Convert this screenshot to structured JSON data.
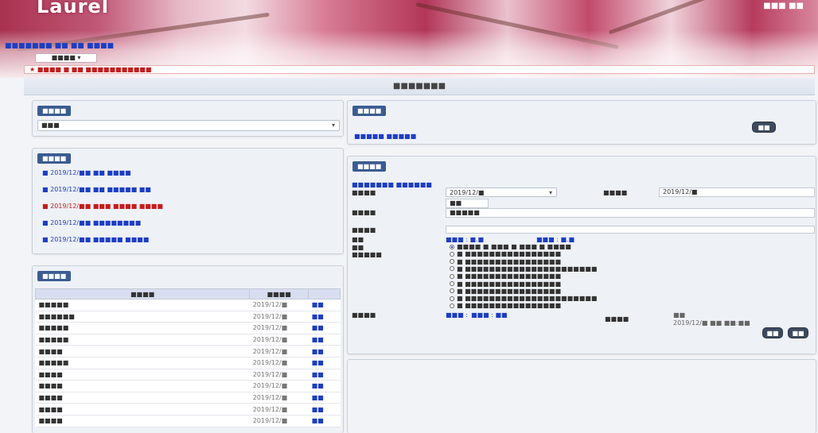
{
  "header": {
    "logo": "Laurel",
    "user": "■■■ ■■",
    "breadcrumb": "■■■■■■■ ■■ ■■ ■■■■",
    "system_button": "■■■■ ▾",
    "notice": "★ ■■■■ ■ ■■ ■■■■■■■■■■■"
  },
  "page_title": "■■■■■■■",
  "category_panel": {
    "header": "■■■■",
    "select_value": "■■■"
  },
  "recent_panel": {
    "header": "■■■■",
    "items": [
      {
        "label": "■ 2019/12/■■ ■■ ■■■■",
        "active": false
      },
      {
        "label": "■ 2019/12/■■ ■■ ■■■■■ ■■",
        "active": false
      },
      {
        "label": "■ 2019/12/■■ ■■■ ■■■■ ■■■■",
        "active": true
      },
      {
        "label": "■ 2019/12/■■ ■■■■■■■■",
        "active": false
      },
      {
        "label": "■ 2019/12/■■ ■■■■■ ■■■■",
        "active": false
      }
    ]
  },
  "list_panel": {
    "header": "■■■■",
    "columns": [
      "■■■■",
      "■■■■",
      ""
    ],
    "rows": [
      {
        "name": "■■■■■",
        "date": "2019/12/■",
        "action": "■■"
      },
      {
        "name": "■■■■■■",
        "date": "2019/12/■",
        "action": "■■"
      },
      {
        "name": "■■■■■",
        "date": "2019/12/■",
        "action": "■■"
      },
      {
        "name": "■■■■■",
        "date": "2019/12/■",
        "action": "■■"
      },
      {
        "name": "■■■■",
        "date": "2019/12/■",
        "action": "■■"
      },
      {
        "name": "■■■■■",
        "date": "2019/12/■",
        "action": "■■"
      },
      {
        "name": "■■■■",
        "date": "2019/12/■",
        "action": "■■"
      },
      {
        "name": "■■■■",
        "date": "2019/12/■",
        "action": "■■"
      },
      {
        "name": "■■■■",
        "date": "2019/12/■",
        "action": "■■"
      },
      {
        "name": "■■■■",
        "date": "2019/12/■",
        "action": "■■"
      },
      {
        "name": "■■■■",
        "date": "2019/12/■",
        "action": "■■"
      }
    ]
  },
  "search_panel": {
    "header": "■■■■",
    "button": "■■",
    "link": "■■■■■ ■■■■■"
  },
  "detail_panel": {
    "header": "■■■■",
    "top_links": "■■■■■■■ ■■■■■■",
    "fields": {
      "type_label": "■■■■",
      "type_value": "2019/12/■",
      "date_label": "■■■■",
      "date_value": "2019/12/■",
      "code_value": "■■",
      "title_label": "■■■■",
      "title_value": "■■■■■",
      "content_label": "■■■■",
      "weight_label": "■■",
      "weight_value": "■■■ : ■.■",
      "weight_value2": "■■■ : ■.■",
      "option_label": "■■",
      "score_label": "■■■■■",
      "remark_label": "■■■■",
      "remark_value": "■■■ :",
      "remark_value2": "■■■ : ■■",
      "author_label": "■■■■",
      "author_value": "■■",
      "time_value": "2019/12/■ ■■ ■■:■■"
    },
    "options": [
      "■■■■ ■ ■■■ ■ ■■■ ■ ■■■■",
      "■ ■■■■■■■■■■■■■■■■",
      "■ ■■■■■■■■■■■■■■■■",
      "■ ■■■■■■■■■■■■■■■■■■■■■■",
      "■ ■■■■■■■■■■■■■■■■",
      "■ ■■■■■■■■■■■■■■■■",
      "■ ■■■■■■■■■■■■■■■■",
      "■ ■■■■■■■■■■■■■■■■■■■■■■",
      "■ ■■■■■■■■■■■■■■■■"
    ],
    "buttons": [
      "■■",
      "■■"
    ]
  }
}
